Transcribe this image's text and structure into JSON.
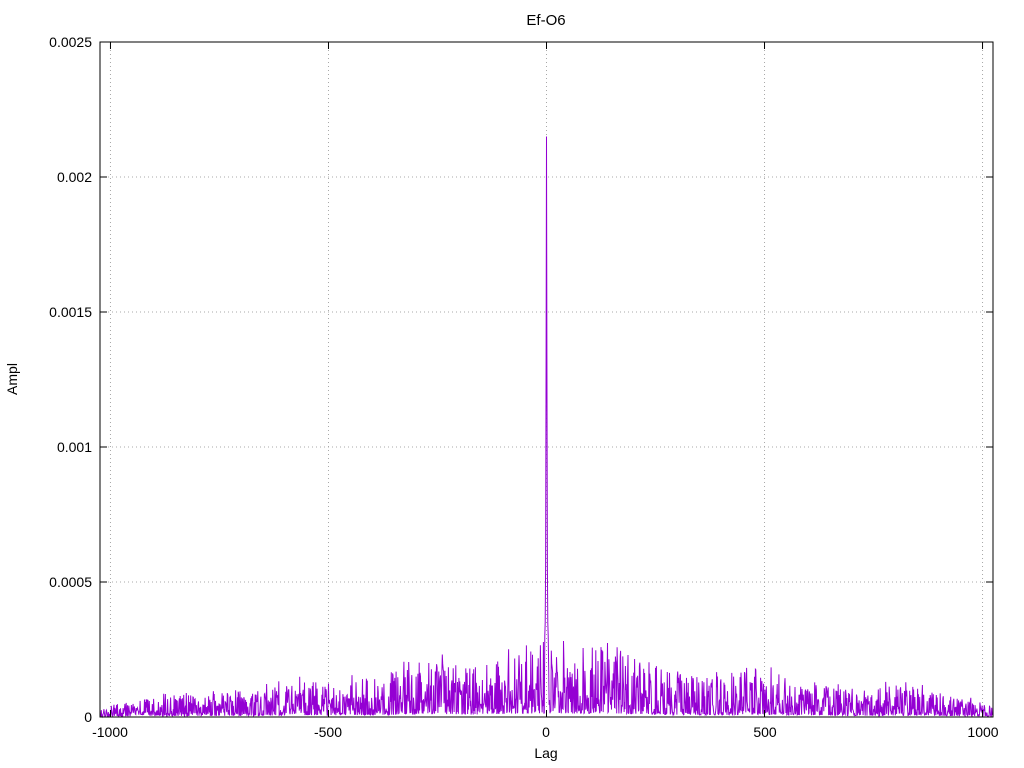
{
  "chart_data": {
    "type": "line",
    "title": "Ef-O6",
    "xlabel": "Lag",
    "ylabel": "Ampl",
    "xlim": [
      -1024,
      1024
    ],
    "ylim": [
      0,
      0.0025
    ],
    "x_ticks": [
      -1000,
      -500,
      0,
      500,
      1000
    ],
    "x_tick_labels": [
      "-1000",
      "-500",
      "0",
      "500",
      "1000"
    ],
    "y_ticks": [
      0,
      0.0005,
      0.001,
      0.0015,
      0.002,
      0.0025
    ],
    "y_tick_labels": [
      "0",
      "0.0005",
      "0.001",
      "0.0015",
      "0.002",
      "0.0025"
    ],
    "grid": true,
    "legend": "none",
    "line_color": "#9400d3",
    "grid_color": "#a8a8a8",
    "border_color": "#000000",
    "background_color": "#ffffff",
    "center_peak": {
      "lags": [
        -4,
        -3,
        -2,
        -1,
        0,
        1,
        2,
        3,
        4
      ],
      "values": [
        0.0003,
        0.00035,
        0.00055,
        0.00134,
        0.00215,
        0.00134,
        0.00055,
        0.00035,
        0.0003
      ]
    },
    "noise_envelope": {
      "lags": [
        -1024,
        -950,
        -850,
        -750,
        -650,
        -550,
        -450,
        -350,
        -280,
        -230,
        -170,
        -110,
        -60,
        -15,
        15,
        60,
        120,
        180,
        250,
        320,
        400,
        470,
        530,
        620,
        720,
        820,
        920,
        1024
      ],
      "peak_amplitudes": [
        4e-05,
        6e-05,
        8e-05,
        9e-05,
        0.0001,
        0.00014,
        0.00013,
        0.00017,
        0.00024,
        0.00019,
        0.00018,
        0.00022,
        0.00025,
        0.00028,
        0.00028,
        0.00025,
        0.00028,
        0.00026,
        0.0002,
        0.00016,
        0.00015,
        0.00019,
        0.00016,
        0.00012,
        0.0001,
        0.00012,
        8e-05,
        4e-05
      ]
    }
  }
}
